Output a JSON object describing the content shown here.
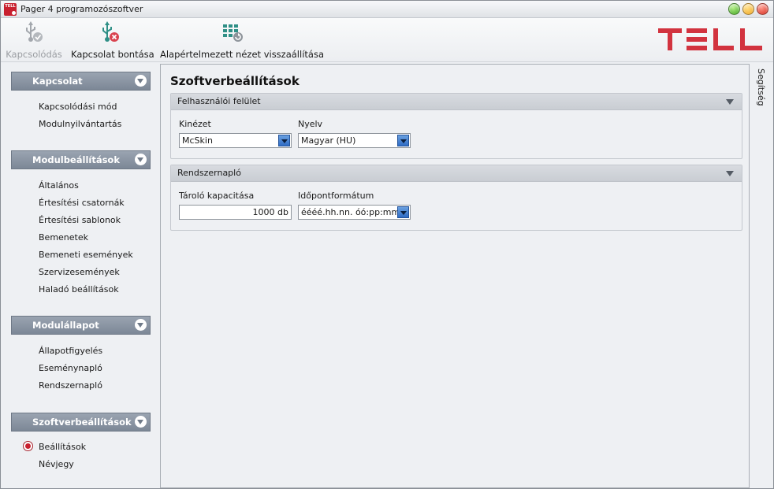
{
  "window": {
    "title": "Pager 4 programozószoftver"
  },
  "toolbar": {
    "connect_label": "Kapcsolódás",
    "disconnect_label": "Kapcsolat bontása",
    "reset_view_label": "Alapértelmezett nézet visszaállítása"
  },
  "brand": {
    "color": "#d2333f"
  },
  "sidebar": {
    "sections": [
      {
        "title": "Kapcsolat",
        "items": [
          "Kapcsolódási mód",
          "Modulnyilvántartás"
        ]
      },
      {
        "title": "Modulbeállítások",
        "items": [
          "Általános",
          "Értesítési csatornák",
          "Értesítési sablonok",
          "Bemenetek",
          "Bemeneti események",
          "Szervizesemények",
          "Haladó beállítások"
        ]
      },
      {
        "title": "Modulállapot",
        "items": [
          "Állapotfigyelés",
          "Eseménynapló",
          "Rendszernapló"
        ]
      },
      {
        "title": "Szoftverbeállítások",
        "items": [
          "Beállítások",
          "Névjegy"
        ],
        "selected": "Beállítások"
      }
    ]
  },
  "main": {
    "title": "Szoftverbeállítások",
    "ui_group": {
      "title": "Felhasználói felület",
      "skin_label": "Kinézet",
      "skin_value": "McSkin",
      "language_label": "Nyelv",
      "language_value": "Magyar (HU)"
    },
    "log_group": {
      "title": "Rendszernapló",
      "capacity_label": "Tároló kapacitása",
      "capacity_value": "1000 db",
      "timeformat_label": "Időpontformátum",
      "timeformat_value": "éééé.hh.nn. óó:pp:mm"
    }
  },
  "help": {
    "label": "Segítség"
  }
}
